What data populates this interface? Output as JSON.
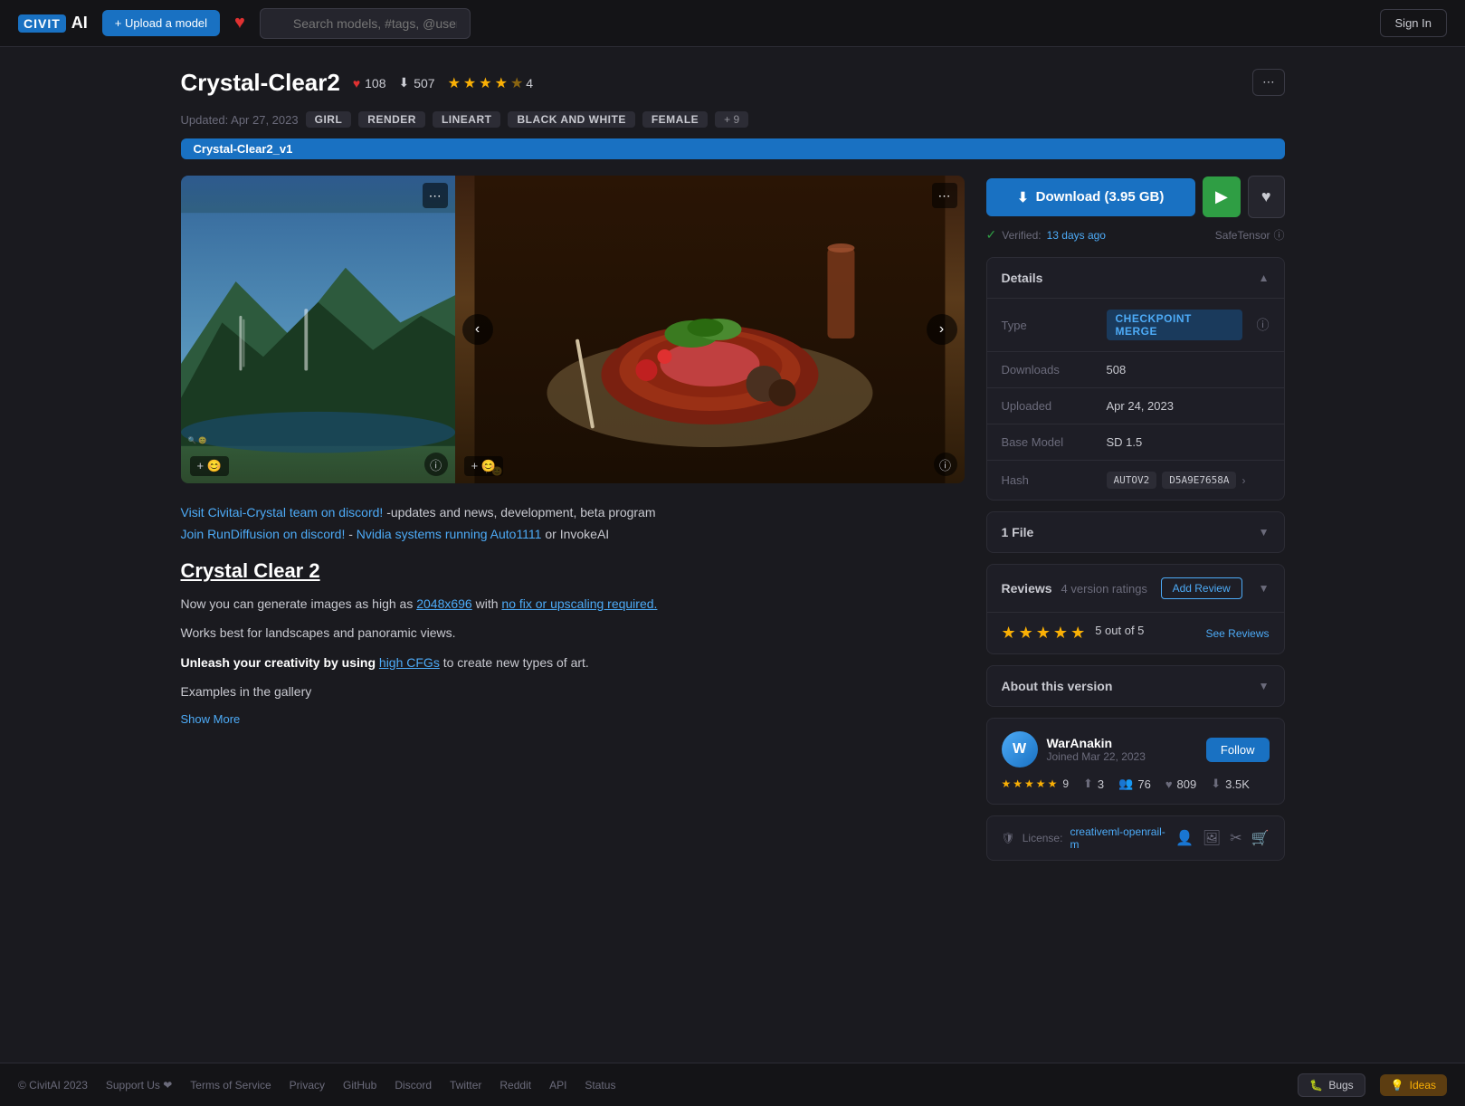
{
  "header": {
    "logo": "CivitAI",
    "upload_label": "+ Upload a model",
    "search_placeholder": "Search models, #tags, @users",
    "sign_in_label": "Sign In"
  },
  "model": {
    "title": "Crystal-Clear2",
    "likes": "108",
    "downloads": "507",
    "rating": 4.5,
    "rating_count": "4",
    "updated": "Updated: Apr 27, 2023",
    "tags": [
      "GIRL",
      "RENDER",
      "LINEART",
      "BLACK AND WHITE",
      "FEMALE"
    ],
    "tags_more": "+ 9",
    "version_badge": "Crystal-Clear2_v1",
    "more_options_label": "⋯"
  },
  "download": {
    "label": "Download (3.95 GB)",
    "verified": "Verified:",
    "verified_date": "13 days ago",
    "safe_tensor": "SafeTensor"
  },
  "details": {
    "title": "Details",
    "type_label": "Type",
    "type_value": "CHECKPOINT MERGE",
    "downloads_label": "Downloads",
    "downloads_value": "508",
    "uploaded_label": "Uploaded",
    "uploaded_value": "Apr 24, 2023",
    "base_model_label": "Base Model",
    "base_model_value": "SD 1.5",
    "hash_label": "Hash",
    "hash_autov2": "AUTOV2",
    "hash_value": "D5A9E7658A"
  },
  "files": {
    "title": "1 File"
  },
  "reviews": {
    "title": "Reviews",
    "version_ratings": "4 version ratings",
    "add_review_label": "Add Review",
    "see_reviews_label": "See Reviews",
    "rating": "5 out of 5",
    "stars": 5
  },
  "about_version": {
    "title": "About this version"
  },
  "author": {
    "name": "WarAnakin",
    "joined": "Joined Mar 22, 2023",
    "follow_label": "Follow",
    "uploads": "3",
    "followers": "76",
    "likes": "809",
    "downloads": "3.5K",
    "rating_count": "9",
    "stars": 5
  },
  "license": {
    "label": "License:",
    "link": "creativeml-openrail-m"
  },
  "description": {
    "discord_line1_prefix": "",
    "discord_link1": "Visit Civitai-Crystal team on discord!",
    "discord_line1_suffix": "-updates and news, development, beta program",
    "discord_link2": "Join RunDiffusion on discord!",
    "discord_line2_suffix": "-",
    "nvidia_link": "Nvidia systems running Auto1111",
    "discord_line2_end": "or InvokeAI",
    "heading": "Crystal Clear 2",
    "para1_prefix": "Now you can generate images as high as ",
    "para1_res": "2048x696",
    "para1_suffix": " with ",
    "para1_nofix": "no fix or upscaling required.",
    "para2": "Works best for landscapes and panoramic views.",
    "para3_prefix": "Unleash your creativity by using ",
    "para3_link": "high CFGs",
    "para3_suffix": " to create new types of art.",
    "para4": "Examples in the gallery",
    "show_more_label": "Show More"
  },
  "footer": {
    "copyright": "© CivitAI 2023",
    "links": [
      "Support Us ❤",
      "Terms of Service",
      "Privacy",
      "GitHub",
      "Discord",
      "Twitter",
      "Reddit",
      "API",
      "Status"
    ],
    "bugs_label": "Bugs",
    "ideas_label": "Ideas"
  }
}
